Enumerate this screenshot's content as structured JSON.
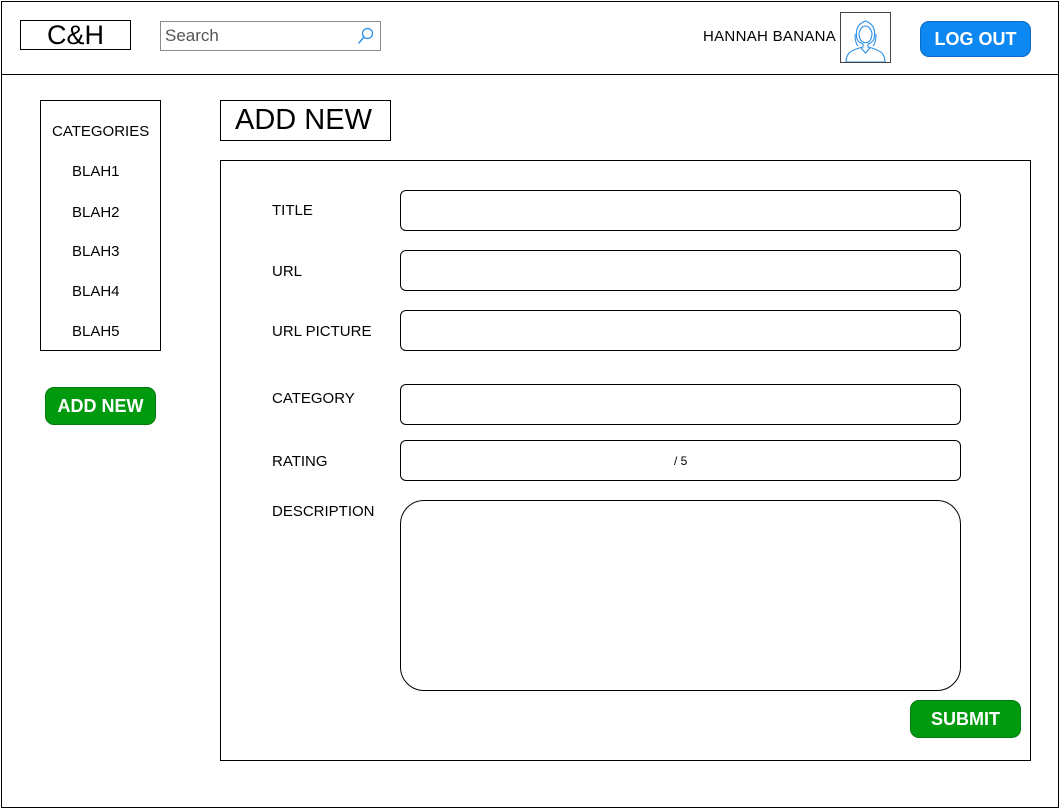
{
  "header": {
    "logo": "C&H",
    "search_placeholder": "Search",
    "user_name": "HANNAH BANANA",
    "logout_label": "LOG OUT"
  },
  "sidebar": {
    "title": "CATEGORIES",
    "items": [
      {
        "label": "BLAH1"
      },
      {
        "label": "BLAH2"
      },
      {
        "label": "BLAH3"
      },
      {
        "label": "BLAH4"
      },
      {
        "label": "BLAH5"
      }
    ],
    "add_new_label": "ADD NEW"
  },
  "main": {
    "title": "ADD NEW",
    "form": {
      "title_label": "TITLE",
      "url_label": "URL",
      "url_picture_label": "URL PICTURE",
      "category_label": "CATEGORY",
      "rating_label": "RATING",
      "rating_suffix": "/ 5",
      "description_label": "DESCRIPTION",
      "submit_label": "SUBMIT"
    }
  },
  "colors": {
    "primary_blue": "#0d88f2",
    "action_green": "#009a0e"
  },
  "icons": {
    "search": "search-icon",
    "avatar": "user-avatar-icon"
  }
}
